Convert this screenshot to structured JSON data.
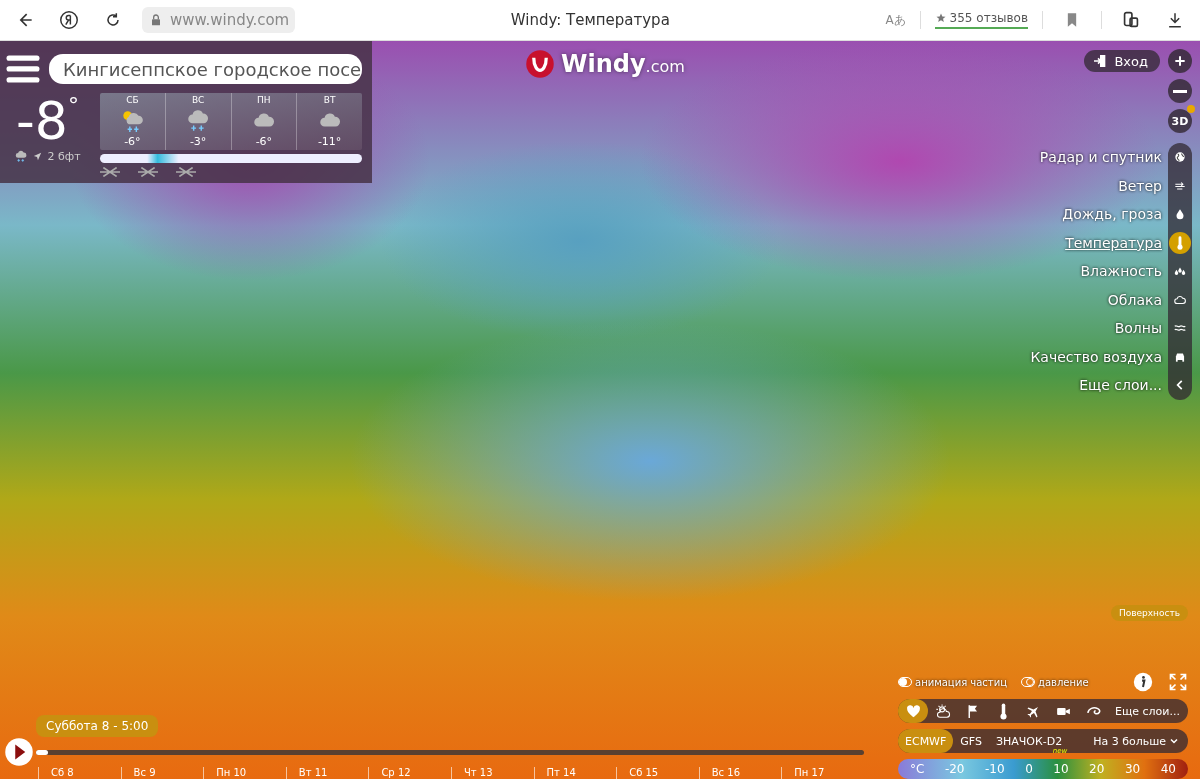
{
  "browser": {
    "address": "www.windy.com",
    "title": "Windy: Температура",
    "translate": "Aあ",
    "reviews": "355 отзывов"
  },
  "logo": {
    "name": "Windy",
    ".com": ".com"
  },
  "widget": {
    "search": "Кингисеппское городское посе",
    "temperature": "-8",
    "degree": "°",
    "wind": "2 бфт",
    "days": [
      {
        "name": "СБ",
        "temp": "-6°",
        "kind": "sun-snow"
      },
      {
        "name": "ВС",
        "temp": "-3°",
        "kind": "snow"
      },
      {
        "name": "ПН",
        "temp": "-6°",
        "kind": "cloud"
      },
      {
        "name": "ВТ",
        "temp": "-11°",
        "kind": "cloud"
      }
    ]
  },
  "login": "Вход",
  "zoom_3d": "3D",
  "layers": [
    {
      "label": "Радар и спутник",
      "kind": "globe",
      "selected": false
    },
    {
      "label": "Ветер",
      "kind": "wind",
      "selected": false
    },
    {
      "label": "Дождь, гроза",
      "kind": "drop",
      "selected": false
    },
    {
      "label": "Температура",
      "kind": "thermo",
      "selected": true
    },
    {
      "label": "Влажность",
      "kind": "humidity",
      "selected": false
    },
    {
      "label": "Облака",
      "kind": "cloud",
      "selected": false
    },
    {
      "label": "Волны",
      "kind": "waves",
      "selected": false
    },
    {
      "label": "Качество воздуха",
      "kind": "car",
      "selected": false
    },
    {
      "label": "Еще слои...",
      "kind": "chevron",
      "selected": false
    }
  ],
  "altitude": "Поверхность",
  "toggles": [
    {
      "label": "анимация частиц",
      "on": true
    },
    {
      "label": "давление",
      "on": false
    }
  ],
  "quick_layers": [
    {
      "kind": "heart",
      "selected": true
    },
    {
      "kind": "sun-cloud",
      "selected": false
    },
    {
      "kind": "flag",
      "selected": false
    },
    {
      "kind": "thermo",
      "selected": false
    },
    {
      "kind": "plane",
      "selected": false
    },
    {
      "kind": "camera",
      "selected": false
    },
    {
      "kind": "swirl",
      "selected": false
    }
  ],
  "more_layers": "Еще слои...",
  "models": [
    {
      "label": "ECMWF",
      "selected": true
    },
    {
      "label": "GFS",
      "selected": false
    },
    {
      "label": "ЗНАЧОК-D2",
      "selected": false,
      "badge": "new"
    }
  ],
  "more_models": "На 3 больше",
  "scale": [
    "°C",
    "-20",
    "-10",
    "0",
    "10",
    "20",
    "30",
    "40"
  ],
  "timeline": {
    "time": "Суббота 8 - 5:00",
    "level": 0.015,
    "days": [
      "Сб 8",
      "Вс 9",
      "Пн 10",
      "Вт 11",
      "Ср 12",
      "Чт 13",
      "Пт 14",
      "Сб 15",
      "Вс 16",
      "Пн 17"
    ]
  }
}
